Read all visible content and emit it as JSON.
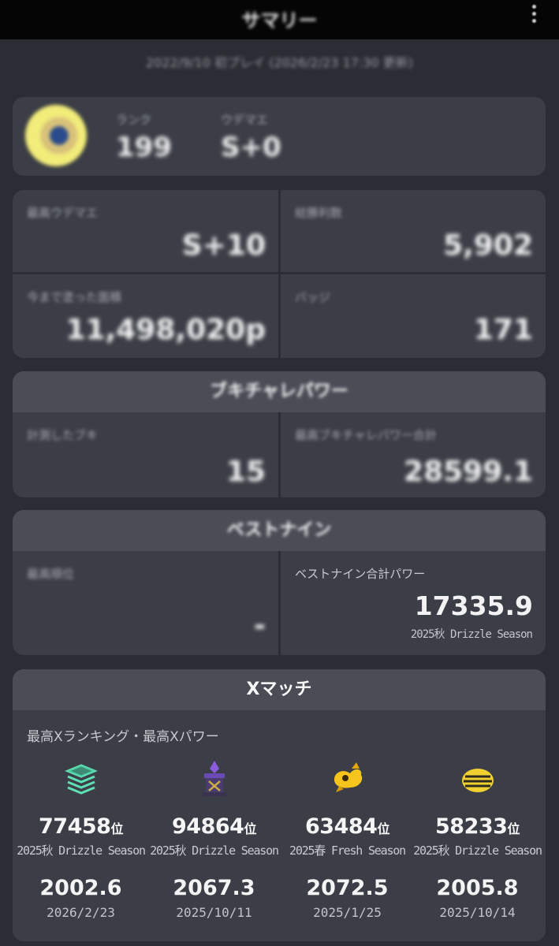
{
  "header": {
    "title": "サマリー"
  },
  "subtitle": "2022/9/10 初プレイ (2026/2/23 17:30 更新)",
  "profile": {
    "rank_label": "ランク",
    "rank_value": "199",
    "udemae_label": "ウデマエ",
    "udemae_value": "S+0"
  },
  "stats": {
    "max_udemae_label": "最高ウデマエ",
    "max_udemae_value": "S+10",
    "total_wins_label": "総勝利数",
    "total_wins_value": "5,902",
    "total_points_label": "今まで塗った面積",
    "total_points_value": "11,498,020p",
    "badges_label": "バッジ",
    "badges_value": "171"
  },
  "weapons": {
    "heading": "ブキチャレパワー",
    "measured_label": "計測したブキ",
    "measured_value": "15",
    "max_power_label": "最高ブキチャレパワー合計",
    "max_power_value": "28599.1"
  },
  "bestnine": {
    "heading": "ベストナイン",
    "max_rank_label": "最高順位",
    "max_rank_value": "-",
    "total_power_label": "ベストナイン合計パワー",
    "total_power_value": "17335.9",
    "season": "2025秋 Drizzle Season"
  },
  "xmatch": {
    "heading": "Xマッチ",
    "label": "最高Xランキング・最高Xパワー",
    "rank_suffix": "位",
    "modes": [
      {
        "icon": "splat-zones-icon",
        "rank": "77458",
        "season": "2025秋 Drizzle Season",
        "power": "2002.6",
        "date": "2026/2/23"
      },
      {
        "icon": "tower-control-icon",
        "rank": "94864",
        "season": "2025秋 Drizzle Season",
        "power": "2067.3",
        "date": "2025/10/11"
      },
      {
        "icon": "rainmaker-icon",
        "rank": "63484",
        "season": "2025春 Fresh Season",
        "power": "2072.5",
        "date": "2025/1/25"
      },
      {
        "icon": "clam-blitz-icon",
        "rank": "58233",
        "season": "2025秋 Drizzle Season",
        "power": "2005.8",
        "date": "2025/10/14"
      }
    ]
  }
}
